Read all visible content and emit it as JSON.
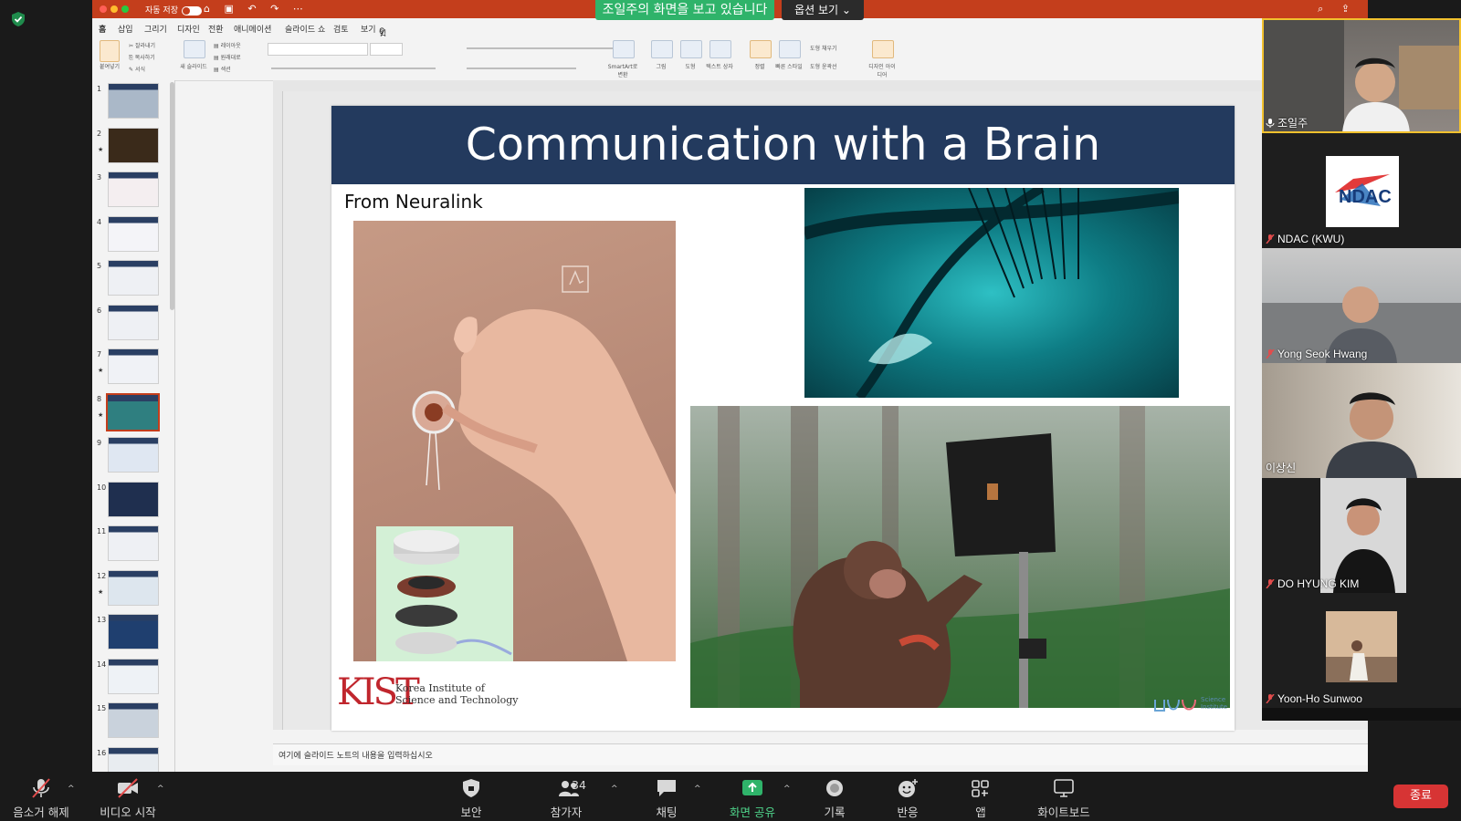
{
  "sharing_banner": "조일주의 화면을 보고 있습니다",
  "view_options": "옵션 보기",
  "ppt": {
    "autosave_label": "자동 저장",
    "ribbon_tabs": [
      "홈",
      "삽입",
      "그리기",
      "디자인",
      "전환",
      "애니메이션",
      "슬라이드 쇼",
      "검토",
      "보기"
    ],
    "tell_me": "입력하세요",
    "ribbon": {
      "paste": "붙여넣기",
      "cut": "잘라내기",
      "copy": "복사하기",
      "format": "서식",
      "new_slide": "새 슬라이드",
      "layout": "레이아웃",
      "reset": "원래대로",
      "section": "섹션",
      "smartart": "SmartArt로 변환",
      "picture": "그림",
      "shapes": "도형",
      "textbox": "텍스트 상자",
      "arrange": "정렬",
      "quick_styles": "빠른 스타일",
      "shape_fill": "도형 채우기",
      "shape_outline": "도형 윤곽선",
      "designer": "디자인 아이디어"
    },
    "thumbnails": [
      "1",
      "2",
      "3",
      "4",
      "5",
      "6",
      "7",
      "8",
      "9",
      "10",
      "11",
      "12",
      "13",
      "14",
      "15",
      "16"
    ],
    "starred": [
      "2",
      "7",
      "8",
      "12"
    ],
    "selected": "8",
    "notes_placeholder": "여기에 슬라이드 노트의 내용을 입력하십시오"
  },
  "slide": {
    "title": "Communication with a Brain",
    "subtitle": "From Neuralink",
    "kist_mark": "KIST",
    "kist_line1": "Korea Institute of",
    "kist_line2": "Science and Technology",
    "si_logo_line1": "Science",
    "si_logo_line2": "Institute"
  },
  "participants": [
    {
      "name": "조일주",
      "muted": false,
      "active": true
    },
    {
      "name": "NDAC (KWU)",
      "muted": true,
      "logo": "NDAC"
    },
    {
      "name": "Yong Seok Hwang",
      "muted": true
    },
    {
      "name": "이상신",
      "muted": false
    },
    {
      "name": "DO HYUNG KIM",
      "muted": true
    },
    {
      "name": "Yoon-Ho Sunwoo",
      "muted": true
    }
  ],
  "toolbar": {
    "unmute": "음소거 해제",
    "start_video": "비디오 시작",
    "security": "보안",
    "participants": "참가자",
    "participant_count": "34",
    "chat": "채팅",
    "share_screen": "화면 공유",
    "record": "기록",
    "reactions": "반응",
    "apps": "앱",
    "whiteboard": "화이트보드",
    "end": "종료"
  },
  "colors": {
    "ppt_accent": "#c43e1c",
    "slide_banner": "#233a5e",
    "share_green": "#2fb36a",
    "end_red": "#d73434"
  }
}
